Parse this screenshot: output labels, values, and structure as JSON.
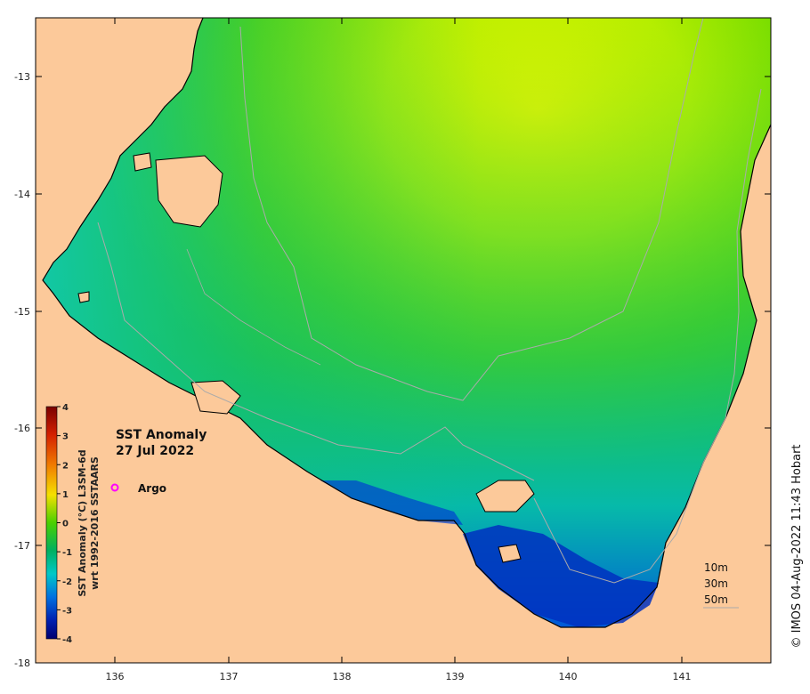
{
  "map": {
    "title_line1": "SST Anomaly",
    "title_line2": "27 Jul 2022",
    "land_color": "#fcc99a",
    "coast_color": "#000000",
    "isobath_color": "#aaaaaa"
  },
  "axes": {
    "x_ticks": [
      "136",
      "137",
      "138",
      "139",
      "140",
      "141"
    ],
    "y_ticks": [
      "-13",
      "-14",
      "-15",
      "-16",
      "-17",
      "-18"
    ]
  },
  "colorbar": {
    "title_line1": "SST Anomaly (°C) L3SM-6d",
    "title_line2": "wrt 1992-2016 SSTAARS",
    "ticks": [
      "4",
      "3",
      "2",
      "1",
      "0",
      "-1",
      "-2",
      "-3",
      "-4"
    ],
    "range": [
      -4,
      4
    ]
  },
  "legend": {
    "argo_label": "Argo",
    "argo_color": "#ff00ff"
  },
  "isobaths": {
    "labels": [
      "10m",
      "30m",
      "50m"
    ]
  },
  "credit": "© IMOS 04-Aug-2022 11:43 Hobart"
}
